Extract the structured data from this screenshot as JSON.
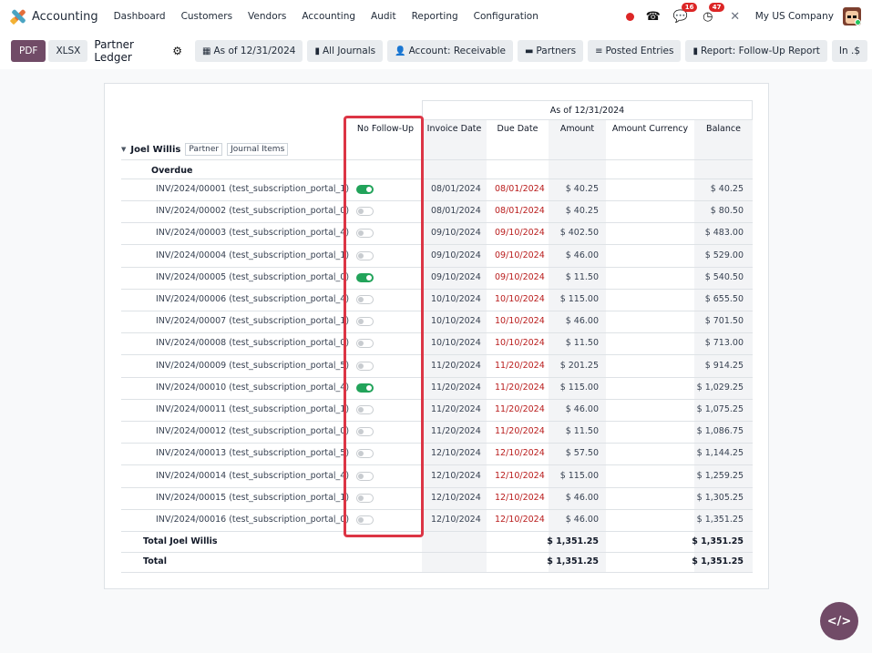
{
  "navbar": {
    "app_name": "Accounting",
    "menu": [
      "Dashboard",
      "Customers",
      "Vendors",
      "Accounting",
      "Audit",
      "Reporting",
      "Configuration"
    ],
    "messages_count": "16",
    "activities_count": "47",
    "company": "My US Company"
  },
  "toolbar": {
    "pdf_label": "PDF",
    "xlsx_label": "XLSX",
    "report_title": "Partner Ledger",
    "filters": [
      {
        "icon": "calendar-icon",
        "label": "As of 12/31/2024"
      },
      {
        "icon": "book-icon",
        "label": "All Journals"
      },
      {
        "icon": "user-icon",
        "label": "Account: Receivable"
      },
      {
        "icon": "folder-icon",
        "label": "Partners"
      },
      {
        "icon": "sliders-icon",
        "label": "Posted Entries"
      },
      {
        "icon": "book-icon",
        "label": "Report: Follow-Up Report"
      },
      {
        "icon": "",
        "label": "In .$"
      }
    ]
  },
  "table": {
    "period_header": "As of 12/31/2024",
    "columns": {
      "no_followup": "No Follow-Up",
      "invoice_date": "Invoice Date",
      "due_date": "Due Date",
      "amount": "Amount",
      "amount_currency": "Amount Currency",
      "balance": "Balance"
    },
    "partner": {
      "name": "Joel Willis",
      "partner_btn": "Partner",
      "journal_items_btn": "Journal Items"
    },
    "section": "Overdue",
    "rows": [
      {
        "name": "INV/2024/00001 (test_subscription_portal_1)",
        "no_followup": true,
        "invoice_date": "08/01/2024",
        "due_date": "08/01/2024",
        "amount": "$ 40.25",
        "balance": "$ 40.25"
      },
      {
        "name": "INV/2024/00002 (test_subscription_portal_0)",
        "no_followup": false,
        "invoice_date": "08/01/2024",
        "due_date": "08/01/2024",
        "amount": "$ 40.25",
        "balance": "$ 80.50"
      },
      {
        "name": "INV/2024/00003 (test_subscription_portal_4)",
        "no_followup": false,
        "invoice_date": "09/10/2024",
        "due_date": "09/10/2024",
        "amount": "$ 402.50",
        "balance": "$ 483.00"
      },
      {
        "name": "INV/2024/00004 (test_subscription_portal_1)",
        "no_followup": false,
        "invoice_date": "09/10/2024",
        "due_date": "09/10/2024",
        "amount": "$ 46.00",
        "balance": "$ 529.00"
      },
      {
        "name": "INV/2024/00005 (test_subscription_portal_0)",
        "no_followup": true,
        "invoice_date": "09/10/2024",
        "due_date": "09/10/2024",
        "amount": "$ 11.50",
        "balance": "$ 540.50"
      },
      {
        "name": "INV/2024/00006 (test_subscription_portal_4)",
        "no_followup": false,
        "invoice_date": "10/10/2024",
        "due_date": "10/10/2024",
        "amount": "$ 115.00",
        "balance": "$ 655.50"
      },
      {
        "name": "INV/2024/00007 (test_subscription_portal_1)",
        "no_followup": false,
        "invoice_date": "10/10/2024",
        "due_date": "10/10/2024",
        "amount": "$ 46.00",
        "balance": "$ 701.50"
      },
      {
        "name": "INV/2024/00008 (test_subscription_portal_0)",
        "no_followup": false,
        "invoice_date": "10/10/2024",
        "due_date": "10/10/2024",
        "amount": "$ 11.50",
        "balance": "$ 713.00"
      },
      {
        "name": "INV/2024/00009 (test_subscription_portal_5)",
        "no_followup": false,
        "invoice_date": "11/20/2024",
        "due_date": "11/20/2024",
        "amount": "$ 201.25",
        "balance": "$ 914.25"
      },
      {
        "name": "INV/2024/00010 (test_subscription_portal_4)",
        "no_followup": true,
        "invoice_date": "11/20/2024",
        "due_date": "11/20/2024",
        "amount": "$ 115.00",
        "balance": "$ 1,029.25"
      },
      {
        "name": "INV/2024/00011 (test_subscription_portal_1)",
        "no_followup": false,
        "invoice_date": "11/20/2024",
        "due_date": "11/20/2024",
        "amount": "$ 46.00",
        "balance": "$ 1,075.25"
      },
      {
        "name": "INV/2024/00012 (test_subscription_portal_0)",
        "no_followup": false,
        "invoice_date": "11/20/2024",
        "due_date": "11/20/2024",
        "amount": "$ 11.50",
        "balance": "$ 1,086.75"
      },
      {
        "name": "INV/2024/00013 (test_subscription_portal_5)",
        "no_followup": false,
        "invoice_date": "12/10/2024",
        "due_date": "12/10/2024",
        "amount": "$ 57.50",
        "balance": "$ 1,144.25"
      },
      {
        "name": "INV/2024/00014 (test_subscription_portal_4)",
        "no_followup": false,
        "invoice_date": "12/10/2024",
        "due_date": "12/10/2024",
        "amount": "$ 115.00",
        "balance": "$ 1,259.25"
      },
      {
        "name": "INV/2024/00015 (test_subscription_portal_1)",
        "no_followup": false,
        "invoice_date": "12/10/2024",
        "due_date": "12/10/2024",
        "amount": "$ 46.00",
        "balance": "$ 1,305.25"
      },
      {
        "name": "INV/2024/00016 (test_subscription_portal_0)",
        "no_followup": false,
        "invoice_date": "12/10/2024",
        "due_date": "12/10/2024",
        "amount": "$ 46.00",
        "balance": "$ 1,351.25"
      }
    ],
    "total_partner": {
      "label": "Total Joel Willis",
      "amount": "$ 1,351.25",
      "balance": "$ 1,351.25"
    },
    "total": {
      "label": "Total",
      "amount": "$ 1,351.25",
      "balance": "$ 1,351.25"
    }
  },
  "colors": {
    "brand": "#714b67",
    "toggle_on": "#22a35a",
    "due_date": "#b91c1c",
    "highlight": "#dc3545"
  },
  "fab_label": "</>"
}
